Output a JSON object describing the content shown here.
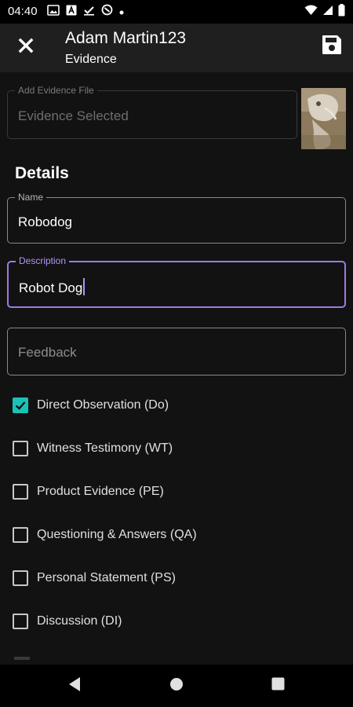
{
  "status_bar": {
    "time": "04:40",
    "left_icons": [
      "gallery-icon",
      "text-icon",
      "check-icon",
      "sync-icon",
      "dot-icon"
    ],
    "right_icons": [
      "wifi-icon",
      "signal-icon",
      "battery-icon"
    ]
  },
  "app_bar": {
    "title": "Adam Martin123",
    "subtitle": "Evidence",
    "close_icon": "close-icon",
    "save_icon": "save-icon"
  },
  "evidence_file": {
    "legend": "Add Evidence File",
    "value": "Evidence Selected"
  },
  "details": {
    "title": "Details",
    "name": {
      "legend": "Name",
      "value": "Robodog"
    },
    "description": {
      "legend": "Description",
      "value": "Robot Dog"
    },
    "feedback": {
      "placeholder": "Feedback"
    }
  },
  "checkboxes": [
    {
      "label": "Direct Observation (Do)",
      "checked": true
    },
    {
      "label": "Witness Testimony (WT)",
      "checked": false
    },
    {
      "label": "Product Evidence (PE)",
      "checked": false
    },
    {
      "label": "Questioning & Answers (QA)",
      "checked": false
    },
    {
      "label": "Personal Statement (PS)",
      "checked": false
    },
    {
      "label": "Discussion (DI)",
      "checked": false
    }
  ],
  "colors": {
    "accent": "#9b7be6",
    "checkbox_checked": "#19c2b6",
    "background": "#121212",
    "app_bar": "#1f1f1f"
  },
  "nav_bar": {
    "back_icon": "back-icon",
    "home_icon": "home-icon",
    "recents_icon": "recents-icon"
  }
}
